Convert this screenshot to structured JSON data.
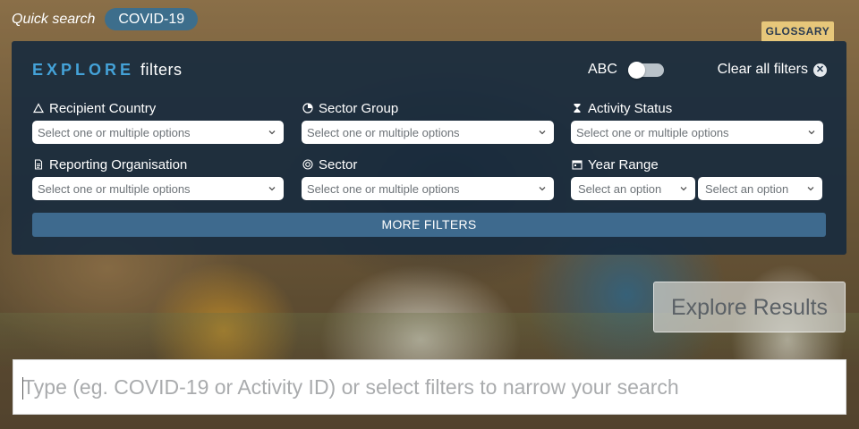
{
  "quick_search": {
    "label": "Quick search",
    "chip": "COVID-19"
  },
  "glossary": {
    "label": "GLOSSARY",
    "bg_color": "#e7c77a"
  },
  "panel": {
    "title_strong": "EXPLORE",
    "title_rest": "filters",
    "abc_label": "ABC",
    "abc_toggle_on": false,
    "clear_label": "Clear all filters",
    "clear_icon": "close-circle-icon",
    "more_filters": "MORE FILTERS",
    "accent_color": "#44a2d8"
  },
  "filters": {
    "recipient_country": {
      "label": "Recipient Country",
      "icon": "triangle-icon",
      "placeholder": "Select one or multiple options"
    },
    "sector_group": {
      "label": "Sector Group",
      "icon": "pie-icon",
      "placeholder": "Select one or multiple options"
    },
    "activity_status": {
      "label": "Activity Status",
      "icon": "hourglass-icon",
      "placeholder": "Select one or multiple options"
    },
    "reporting_organisation": {
      "label": "Reporting Organisation",
      "icon": "document-icon",
      "placeholder": "Select one or multiple options"
    },
    "sector": {
      "label": "Sector",
      "icon": "target-icon",
      "placeholder": "Select one or multiple options"
    },
    "year_range": {
      "label": "Year Range",
      "icon": "calendar-icon",
      "from_placeholder": "Select an option",
      "to_placeholder": "Select an option"
    }
  },
  "explore_results": {
    "label": "Explore Results"
  },
  "search": {
    "placeholder": "Type (eg. COVID-19 or Activity ID) or select filters to narrow your search",
    "value": ""
  }
}
